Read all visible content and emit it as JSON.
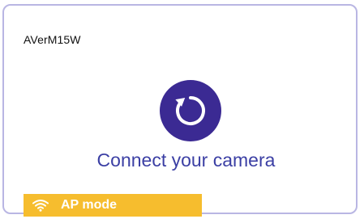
{
  "card": {
    "device_name": "AVerM15W",
    "action_label": "Connect your camera",
    "action_icon": "refresh-icon",
    "mode": {
      "icon": "wifi-icon",
      "label": "AP mode",
      "color": "#f6bd2e"
    }
  },
  "colors": {
    "border": "#b9b6e3",
    "accent": "#3b2a93",
    "link_text": "#3b3fa4"
  }
}
